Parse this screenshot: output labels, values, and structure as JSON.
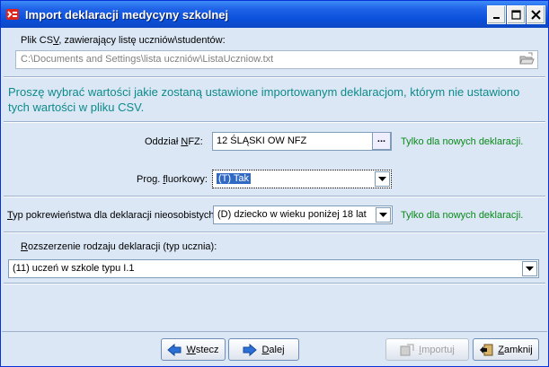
{
  "window": {
    "title": "Import deklaracji medycyny szkolnej",
    "minimize_glyph": "_",
    "maximize_glyph": "□",
    "close_glyph": "X"
  },
  "csv": {
    "label_prefix": "Plik CS",
    "label_accel": "V",
    "label_suffix": ", zawierający listę uczniów\\studentów:",
    "path": "C:\\Documents and Settings\\lista uczniów\\ListaUczniow.txt"
  },
  "info_text": "Proszę wybrać wartości jakie zostaną ustawione importowanym deklaracjom, którym nie ustawiono tych wartości w pliku CSV.",
  "nfz": {
    "label_prefix": "Oddział ",
    "label_accel": "N",
    "label_suffix": "FZ:",
    "value": "12 ŚLĄSKI OW NFZ",
    "button": "...",
    "note": "Tylko dla nowych deklaracji."
  },
  "fluor": {
    "label_prefix": "Prog. ",
    "label_accel": "f",
    "label_suffix": "luorkowy:",
    "value": "(T) Tak"
  },
  "relation": {
    "label_accel": "T",
    "label_suffix": "yp pokrewieństwa dla deklaracji nieosobistych:",
    "value": "(D) dziecko w wieku poniżej 18 lat",
    "note": "Tylko dla nowych deklaracji."
  },
  "extension": {
    "label_accel": "R",
    "label_suffix": "ozszerzenie rodzaju deklaracji (typ ucznia):",
    "value": "(11) uczeń w szkole typu I.1"
  },
  "buttons": {
    "back": {
      "accel": "W",
      "rest": "stecz"
    },
    "next": {
      "accel": "D",
      "rest": "alej"
    },
    "import": {
      "accel": "I",
      "rest": "mportuj"
    },
    "close": {
      "accel": "Z",
      "rest": "amknij"
    }
  },
  "colors": {
    "title_bar": "#0a4fd9",
    "info_text": "#0d8a8a",
    "note_text": "#0a8a1a",
    "selection": "#316ac5"
  }
}
